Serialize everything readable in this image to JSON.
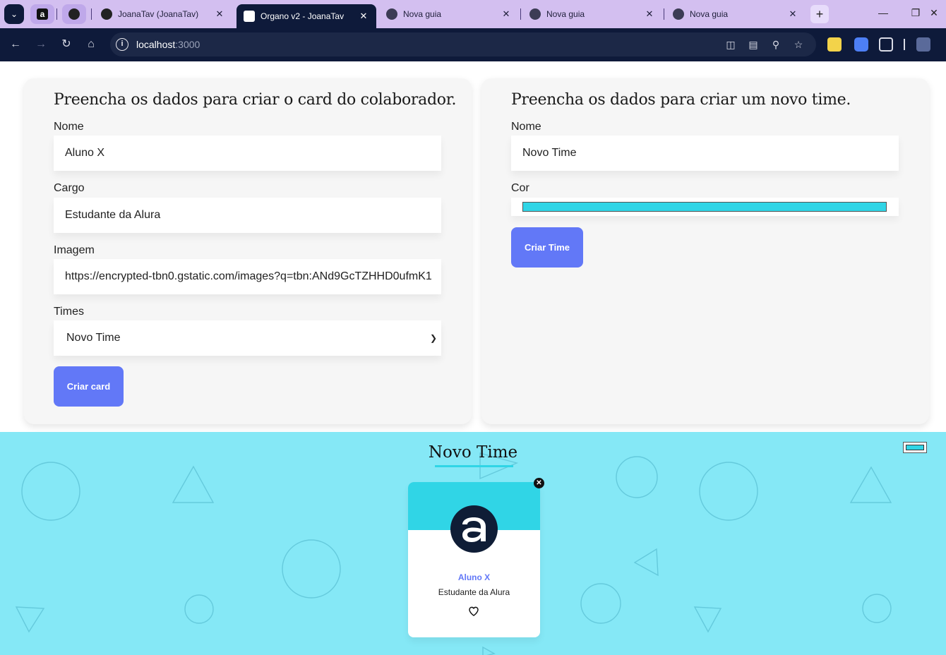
{
  "browser": {
    "tabs": [
      {
        "title": "JoanaTav (JoanaTav)"
      },
      {
        "title": "Organo v2 - JoanaTav"
      },
      {
        "title": "Nova guia"
      },
      {
        "title": "Nova guia"
      },
      {
        "title": "Nova guia"
      }
    ],
    "pinned_icon_a": "a",
    "close_glyph": "✕",
    "new_tab_glyph": "+",
    "url_host": "localhost",
    "url_port": ":3000"
  },
  "collaborator_form": {
    "title": "Preencha os dados para criar o card do colaborador.",
    "name_label": "Nome",
    "name_value": "Aluno X",
    "role_label": "Cargo",
    "role_value": "Estudante da Alura",
    "image_label": "Imagem",
    "image_value": "https://encrypted-tbn0.gstatic.com/images?q=tbn:ANd9GcTZHHD0ufmK1",
    "team_label": "Times",
    "team_value": "Novo Time",
    "submit_label": "Criar card"
  },
  "team_form": {
    "title": "Preencha os dados para criar um novo time.",
    "name_label": "Nome",
    "name_value": "Novo Time",
    "color_label": "Cor",
    "submit_label": "Criar Time"
  },
  "team_section": {
    "title": "Novo Time",
    "members": [
      {
        "name": "Aluno X",
        "role": "Estudante da Alura"
      }
    ]
  },
  "colors": {
    "team_color": "#30d5e6",
    "team_background": "#85e8f6",
    "button": "#6278f7",
    "name_text": "#6278f7",
    "chrome_dark": "#0e1a3a",
    "tabbar": "#d3bff0"
  }
}
